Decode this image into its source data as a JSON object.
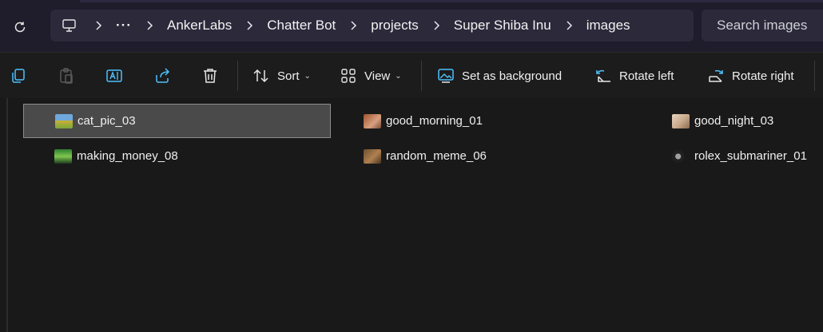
{
  "breadcrumb": {
    "overflow_label": "···",
    "items": [
      "AnkerLabs",
      "Chatter Bot",
      "projects",
      "Super Shiba Inu",
      "images"
    ]
  },
  "search": {
    "placeholder": "Search images"
  },
  "toolbar": {
    "sort_label": "Sort",
    "view_label": "View",
    "set_background_label": "Set as background",
    "rotate_left_label": "Rotate left",
    "rotate_right_label": "Rotate right",
    "icons": [
      "copy-icon",
      "paste-icon",
      "rename-icon",
      "share-icon",
      "delete-icon"
    ]
  },
  "files": [
    {
      "name": "cat_pic_03",
      "selected": true,
      "thumb_colors": [
        "#6fa8dc",
        "#c9b037"
      ]
    },
    {
      "name": "good_morning_01",
      "selected": false,
      "thumb_colors": [
        "#a0522d",
        "#d8a080"
      ]
    },
    {
      "name": "good_night_03",
      "selected": false,
      "thumb_colors": [
        "#e8d4c0",
        "#8a6b50"
      ]
    },
    {
      "name": "making_money_08",
      "selected": false,
      "thumb_colors": [
        "#2e7d32",
        "#7ec850"
      ]
    },
    {
      "name": "random_meme_06",
      "selected": false,
      "thumb_colors": [
        "#6b5030",
        "#b08050"
      ]
    },
    {
      "name": "rolex_submariner_01",
      "selected": false,
      "thumb_colors": [
        "#202020",
        "#a0a0a0"
      ]
    }
  ],
  "colors": {
    "accent": "#4cc2ff",
    "background": "#191919",
    "selection": "#4a4a4a"
  }
}
